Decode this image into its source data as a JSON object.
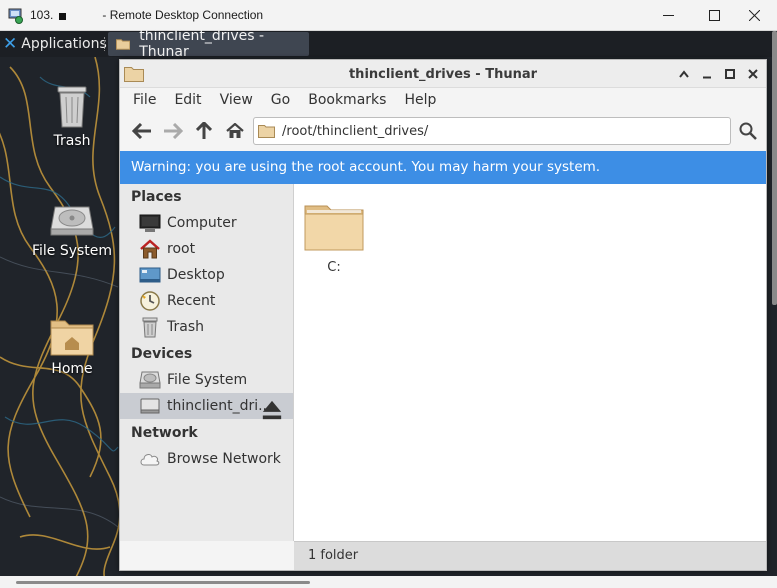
{
  "rdp": {
    "title_prefix": "103.",
    "title": "- Remote Desktop Connection"
  },
  "panel": {
    "applications": "Applications",
    "task_title": "thinclient_drives - Thunar"
  },
  "desktop": {
    "icons": [
      {
        "label": "Trash"
      },
      {
        "label": "File System"
      },
      {
        "label": "Home"
      }
    ]
  },
  "thunar": {
    "title": "thinclient_drives - Thunar",
    "menu": [
      "File",
      "Edit",
      "View",
      "Go",
      "Bookmarks",
      "Help"
    ],
    "path": "/root/thinclient_drives/",
    "warning": "Warning: you are using the root account. You may harm your system.",
    "sidebar": {
      "places_heading": "Places",
      "places": [
        "Computer",
        "root",
        "Desktop",
        "Recent",
        "Trash"
      ],
      "devices_heading": "Devices",
      "devices": [
        "File System",
        "thinclient_dri..."
      ],
      "network_heading": "Network",
      "network": [
        "Browse Network"
      ]
    },
    "files": [
      {
        "name": "C:"
      }
    ],
    "status": "1 folder"
  },
  "colors": {
    "accent": "#3d8ee5",
    "folder": "#e8c690",
    "selection": "#c9ccd2"
  }
}
